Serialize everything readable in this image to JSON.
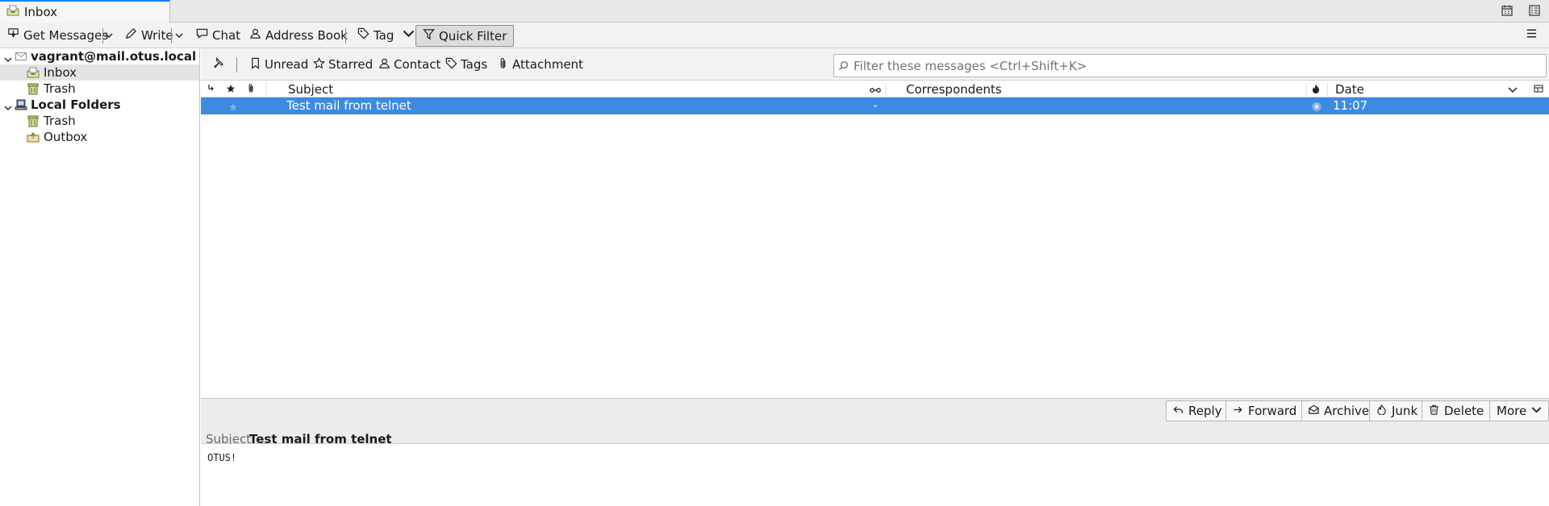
{
  "tab": {
    "label": "Inbox"
  },
  "toolbar": {
    "get_messages": "Get Messages",
    "write": "Write",
    "chat": "Chat",
    "address_book": "Address Book",
    "tag": "Tag",
    "quick_filter": "Quick Filter"
  },
  "folders": {
    "account": "vagrant@mail.otus.local",
    "account_inbox": "Inbox",
    "account_trash": "Trash",
    "local_folders": "Local Folders",
    "local_trash": "Trash",
    "local_outbox": "Outbox"
  },
  "quickfilter": {
    "unread": "Unread",
    "starred": "Starred",
    "contact": "Contact",
    "tags": "Tags",
    "attachment": "Attachment",
    "search_placeholder": "Filter these messages <Ctrl+Shift+K>"
  },
  "columns": {
    "subject": "Subject",
    "correspondents": "Correspondents",
    "date": "Date"
  },
  "messages": [
    {
      "subject": "Test mail from telnet",
      "correspondents": "",
      "date": "11:07"
    }
  ],
  "header": {
    "reply": "Reply",
    "forward": "Forward",
    "archive": "Archive",
    "junk": "Junk",
    "delete": "Delete",
    "more": "More",
    "subject_label": "Subject",
    "subject_value": "Test mail from telnet"
  },
  "body": {
    "text": "OTUS!"
  },
  "colors": {
    "selection": "#3d8ae3",
    "tab_accent": "#0a84ff"
  }
}
